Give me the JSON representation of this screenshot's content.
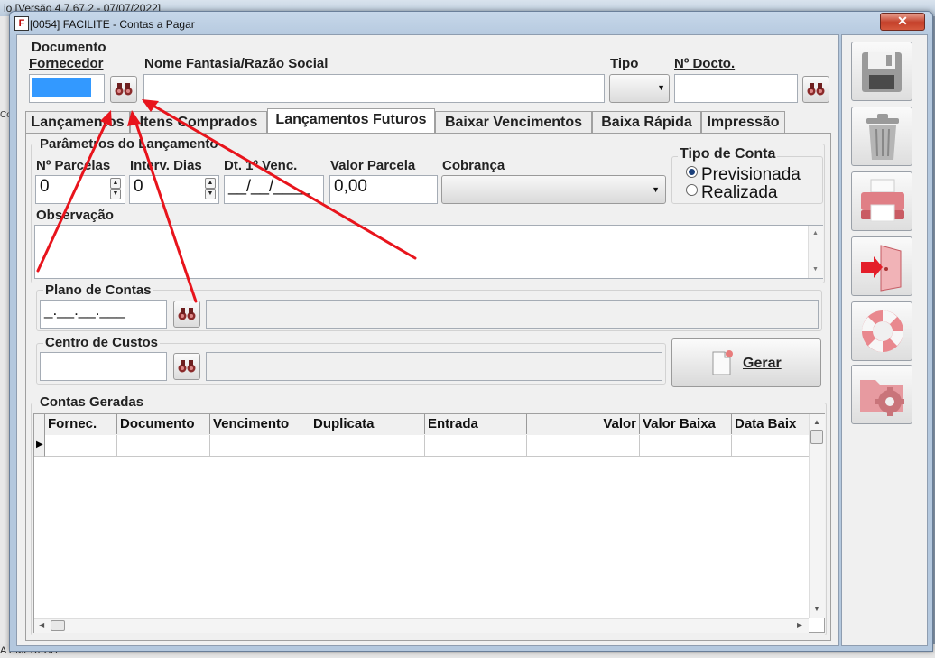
{
  "background_app": {
    "title_fragment": "io [Versão 4.7.67.2 - 07/07/2022]",
    "left_fragment": "Co",
    "bottom_fragment": "A EMPRESA"
  },
  "window": {
    "title": "[0054] FACILITE - Contas a Pagar",
    "logo_letter": "F",
    "close_symbol": "✕"
  },
  "header": {
    "documento_label": "Documento",
    "fornecedor_label": "Fornecedor",
    "fornecedor_value": "",
    "nome_label": "Nome Fantasia/Razão Social",
    "nome_value": "",
    "tipo_label": "Tipo",
    "tipo_value": "",
    "ndocto_label": "Nº Docto.",
    "ndocto_value": ""
  },
  "tabs": [
    {
      "label": "Lançamentos",
      "active": false
    },
    {
      "label": "Itens Comprados",
      "active": false
    },
    {
      "label": "Lançamentos Futuros",
      "active": true
    },
    {
      "label": "Baixar Vencimentos",
      "active": false
    },
    {
      "label": "Baixa Rápida",
      "active": false
    },
    {
      "label": "Impressão",
      "active": false
    }
  ],
  "params": {
    "group_title": "Parâmetros do Lançamento",
    "n_parcelas_label": "Nº Parcelas",
    "n_parcelas_value": "0",
    "interv_label": "Interv. Dias",
    "interv_value": "0",
    "dt_label": "Dt. 1º Venc.",
    "dt_value": "__/__/____",
    "valor_label": "Valor Parcela",
    "valor_value": "0,00",
    "cobranca_label": "Cobrança",
    "cobranca_value": "",
    "tipo_conta_label": "Tipo de Conta",
    "tipo_conta_options": [
      "Previsionada",
      "Realizada"
    ],
    "tipo_conta_selected": "Previsionada",
    "observacao_label": "Observação",
    "observacao_value": ""
  },
  "plano": {
    "label": "Plano de Contas",
    "mask": "_.__.__.___",
    "description": ""
  },
  "centro": {
    "label": "Centro de Custos",
    "value": "",
    "description": ""
  },
  "gerar_button": {
    "label": "Gerar"
  },
  "grid": {
    "title": "Contas Geradas",
    "columns": [
      "Fornec.",
      "Documento",
      "Vencimento",
      "Duplicata",
      "Entrada",
      "Valor",
      "Valor Baixa",
      "Data Baix"
    ],
    "rows": [
      [
        "",
        "",
        "",
        "",
        "",
        "",
        "",
        ""
      ]
    ]
  },
  "toolbar": [
    {
      "name": "save-icon"
    },
    {
      "name": "trash-icon"
    },
    {
      "name": "printer-icon"
    },
    {
      "name": "exit-door-icon"
    },
    {
      "name": "help-lifebuoy-icon"
    },
    {
      "name": "settings-folder-icon"
    }
  ],
  "colors": {
    "window_frame": "#b4c8de",
    "client_bg": "#f0f0f0",
    "annotation_arrow": "#e8141c",
    "close_button": "#c4402a",
    "selected_input": "#3399ff"
  }
}
